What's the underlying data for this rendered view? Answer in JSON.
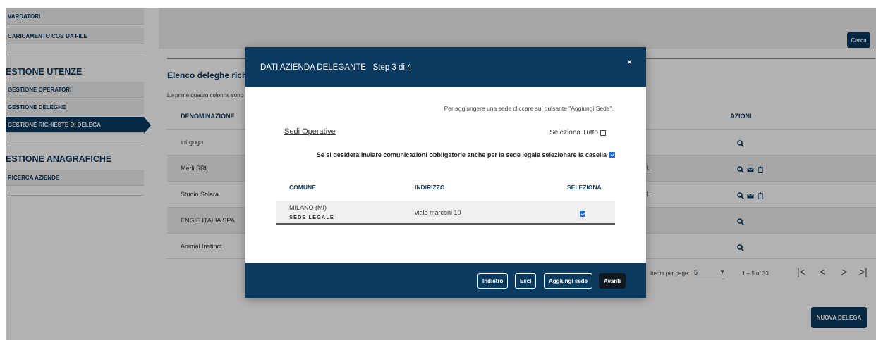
{
  "sidebar": {
    "items_top": [
      "VARDATORI",
      "CARICAMENTO COB DA FILE"
    ],
    "section_utenze": "ESTIONE UTENZE",
    "utenze_items": [
      "GESTIONE OPERATORI",
      "GESTIONE DELEGHE",
      "GESTIONE RICHIESTE DI DELEGA"
    ],
    "section_anagrafiche": "ESTIONE ANAGRAFICHE",
    "anagrafiche_items": [
      "RICERCA AZIENDE"
    ]
  },
  "header": {
    "search_label": "Cerca"
  },
  "main": {
    "title": "Elenco deleghe richieste",
    "subtitle": "Le prime quattro colonne sono",
    "col_denominazione": "DENOMINAZIONE",
    "col_azioni": "AZIONI",
    "rows": [
      {
        "name": "int gogo",
        "tail": ""
      },
      {
        "name": "Merli SRL",
        "tail": "L"
      },
      {
        "name": "Studio Solara",
        "tail": "L"
      },
      {
        "name": "ENGIE ITALIA SPA",
        "tail": ""
      },
      {
        "name": "Animal Instinct",
        "tail": ""
      }
    ],
    "pager": {
      "items_per_page_label": "Items per page:",
      "items_per_page_value": "5",
      "range": "1 – 5 of 33"
    },
    "new_label": "NUOVA DELEGA"
  },
  "modal": {
    "title": "DATI AZIENDA DELEGANTE",
    "step": "Step 3 di 4",
    "close": "×",
    "hint": "Per aggiungere una sede cliccare sul pulsante \"Aggiungi Sede\".",
    "sedi_label": "Sedi Operative",
    "select_all_label": "Seleziona Tutto",
    "legal_label": "Se si desidera inviare comunicazioni obbligatorie anche per la sede legale selezionare la casella",
    "legal_checked": true,
    "table": {
      "headers": [
        "COMUNE",
        "INDIRIZZO",
        "SELEZIONA"
      ],
      "row": {
        "comune": "MILANO (MI)",
        "tag": "SEDE LEGALE",
        "indirizzo": "viale marconi 10",
        "selected": true
      }
    },
    "buttons": {
      "back": "Indietro",
      "exit": "Esci",
      "add": "Aggiungi sede",
      "next": "Avanti"
    }
  },
  "colors": {
    "primary": "#0b3a60",
    "check": "#1e6fd9"
  }
}
